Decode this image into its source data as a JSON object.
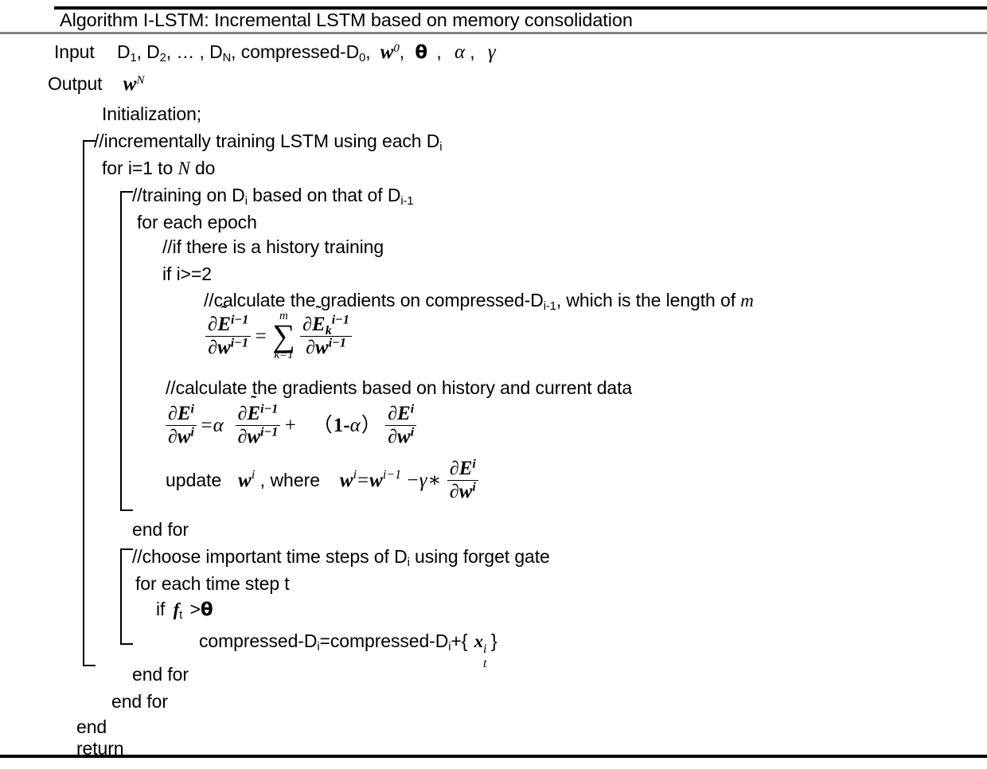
{
  "algorithm": {
    "title": "Algorithm I-LSTM: Incremental LSTM based on memory consolidation",
    "io": {
      "input_label": "Input",
      "input_datasets": "D",
      "input_text_a": "D",
      "input_value": "D1, D2, … , DN, compressed-D0, w0, θ , α , γ",
      "output_label": "Output",
      "output_value": "wN"
    },
    "lines": {
      "initialization": "Initialization;",
      "comment_incremental": "//incrementally training LSTM using each D",
      "for_i": "for i=1 to N do",
      "comment_training_on": "//training on D",
      "comment_training_mid": " based on that of D",
      "for_each_epoch": "for each epoch",
      "comment_history": "//if there is a history training",
      "if_i_ge_2": "if i>=2",
      "comment_gradients_compressed": "//calculate the gradients on compressed-D",
      "comment_gradients_compressed_tail": ", which is the length of ",
      "comment_gradients_compressed_tail_var": "m",
      "comment_gradients_history": "//calculate the gradients based on history and current data",
      "update_prefix": "update",
      "update_where": ", where",
      "end_for_inner": "end for",
      "comment_forget_gate": "//choose important time steps of D",
      "comment_forget_gate_tail": " using forget gate",
      "for_each_time_step": "for each time step t",
      "if_f_gt_theta_prefix": "if",
      "if_f_gt_theta_op": ">",
      "compressed_assign": "compressed-D",
      "compressed_assign_mid": "=compressed-D",
      "compressed_assign_plus": "+{",
      "compressed_assign_close": "}",
      "end_for_middle": "end for",
      "end_for_outer": "end for",
      "end": "end",
      "return": "return"
    },
    "symbols": {
      "partial": "∂",
      "sum": "∑",
      "tilde": "˜",
      "theta": "θ",
      "alpha": "α",
      "gamma": "γ",
      "asterisk": "*",
      "minus": "−",
      "plus": "+",
      "equals": "=",
      "E": "E",
      "w": "w",
      "f": "f",
      "x": "x",
      "m": "m",
      "k": "k",
      "i": "i",
      "t": "t",
      "N": "N",
      "one": "1",
      "k_eq_1": "k=1",
      "i_minus_1": "i−1",
      "one_minus_alpha_open": "(",
      "one_minus_alpha_1": "1",
      "one_minus_alpha_dash": "-",
      "one_minus_alpha_close": ")"
    },
    "formula_gradient_sum": {
      "lhs_num": "∂Ẽ i-1",
      "lhs_den": "∂w i-1",
      "rhs_num": "∂Ẽ k i-1",
      "rhs_den": "∂w i-1",
      "sum_upper": "m",
      "sum_lower": "k=1"
    },
    "formula_combined_gradient": {
      "lhs_num": "∂E i",
      "lhs_den": "∂w i",
      "term1_coeff": "α",
      "term1_num": "∂Ẽ i-1",
      "term1_den": "∂w i-1",
      "term2_coeff": "(1-α)",
      "term2_num": "∂E i",
      "term2_den": "∂w i"
    },
    "formula_update": {
      "lhs": "w i",
      "rhs_prev": "w i-1",
      "rate": "γ",
      "num": "∂E i",
      "den": "∂w i"
    }
  },
  "colors": {
    "text": "#000000",
    "rule_strong": "#000000",
    "rule_light": "#808080",
    "background": "#ffffff"
  }
}
